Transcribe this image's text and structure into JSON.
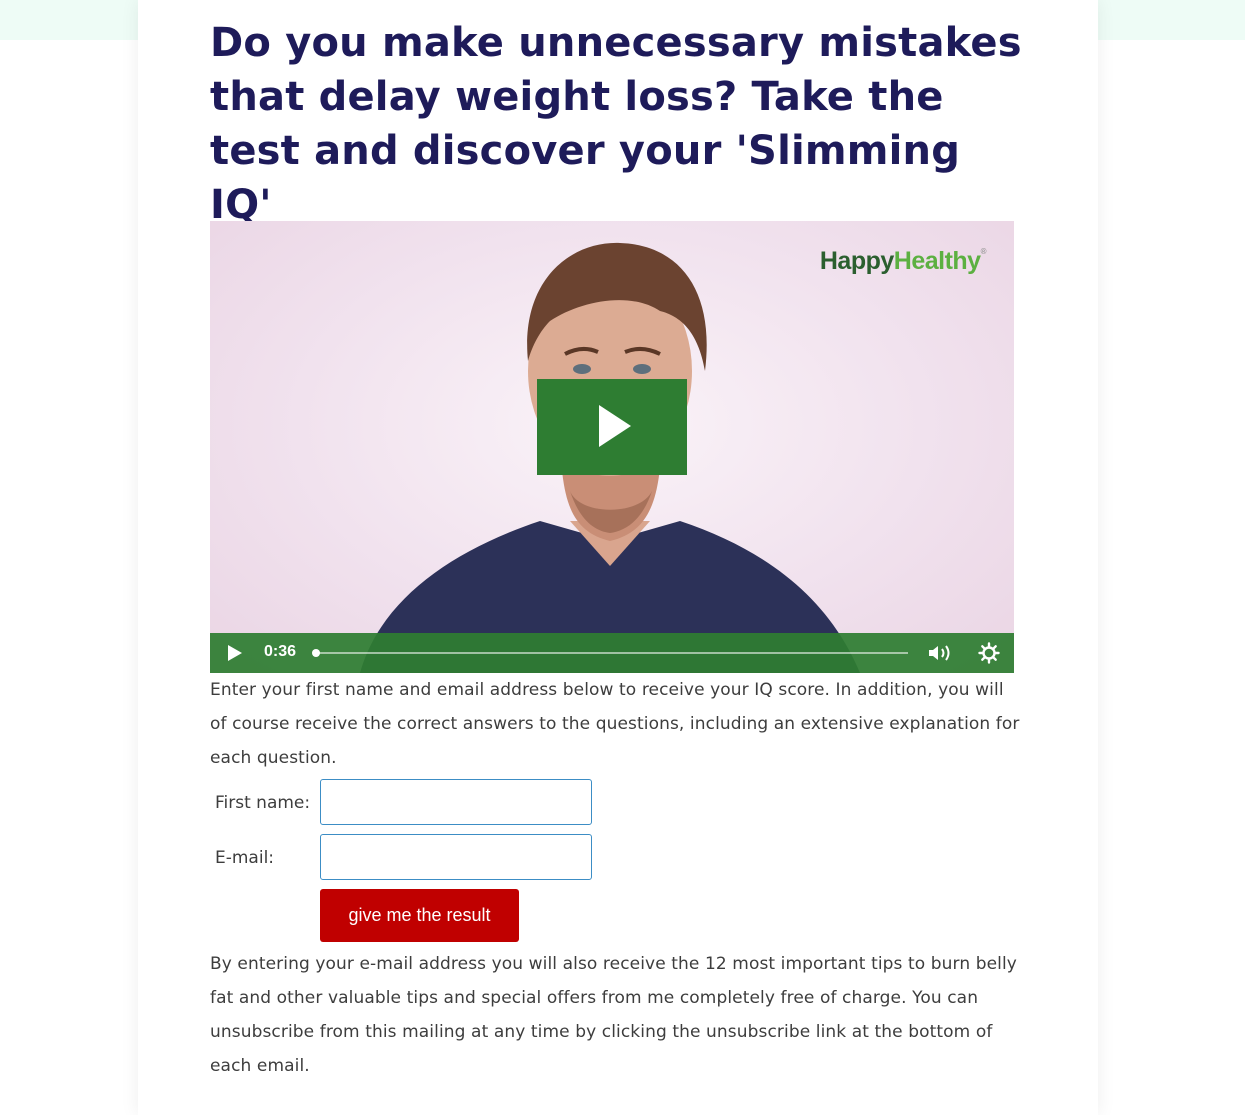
{
  "headline": "Do you make unnecessary mistakes that delay weight loss? Take the test and discover your 'Slimming IQ'",
  "video": {
    "brand_part1": "Happy",
    "brand_part2": "Healthy",
    "brand_mark": "®",
    "current_time": "0:36",
    "progress_fraction": 0.0,
    "play_icon": "play-icon",
    "volume_icon": "volume-icon",
    "settings_icon": "gear-icon",
    "accent_color": "#2e7d32"
  },
  "intro_text": "Enter your first name and email address below to receive your IQ score. In addition, you will of course receive the correct answers to the questions, including an extensive explanation for each question.",
  "form": {
    "first_name_label": "First name:",
    "first_name_value": "",
    "email_label": "E-mail:",
    "email_value": "",
    "submit_label": "give me the result"
  },
  "disclaimer_text": "By entering your e-mail address you will also receive the 12 most important tips to burn belly fat and other valuable tips and special offers from me completely free of charge. You can unsubscribe from this mailing at any time by clicking the unsubscribe link at the bottom of each email.",
  "colors": {
    "headline": "#1e1b5a",
    "button": "#c00000",
    "input_border": "#3c8dc5",
    "top_band": "#eefcf6"
  }
}
